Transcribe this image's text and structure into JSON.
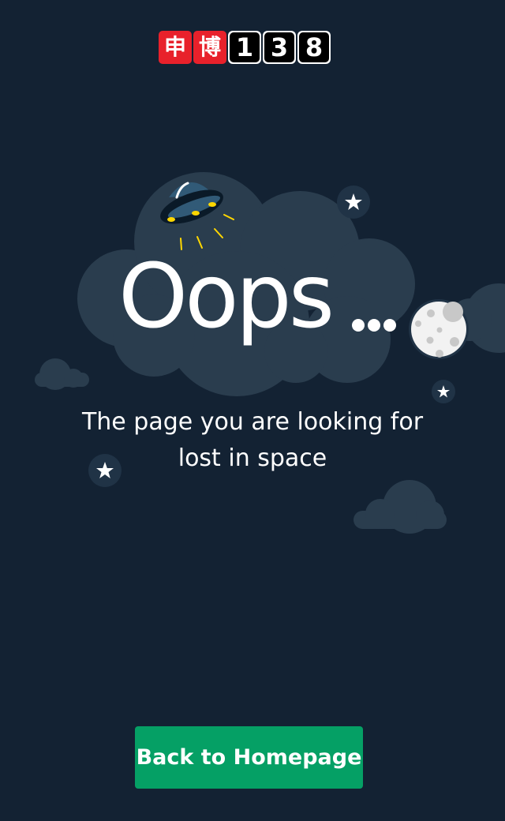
{
  "logo": {
    "char1": "申",
    "char2": "博",
    "digits": [
      "1",
      "3",
      "8"
    ]
  },
  "error": {
    "title": "Oops",
    "message_line1": "The page you are looking for",
    "message_line2": "lost in space"
  },
  "actions": {
    "home_button_label": "Back to Homepage"
  },
  "theme": {
    "background": "#132233",
    "cloud": "#2a3d4e",
    "accent_green": "#05a065",
    "logo_red": "#e8212b",
    "ufo_light": "#ffd700"
  },
  "icons": {
    "logo": "brand-logo",
    "ufo": "ufo-icon",
    "moon": "moon-icon",
    "star": "star-icon",
    "cloud": "cloud-icon"
  }
}
